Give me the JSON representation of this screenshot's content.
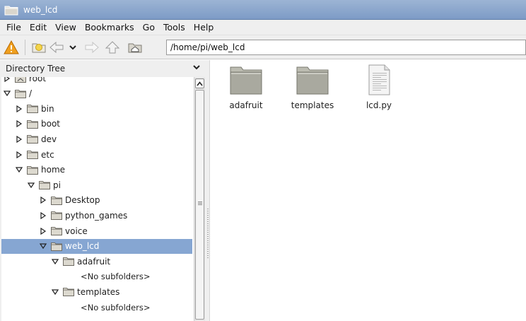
{
  "window": {
    "title": "web_lcd"
  },
  "menu": [
    "File",
    "Edit",
    "View",
    "Bookmarks",
    "Go",
    "Tools",
    "Help"
  ],
  "toolbar": {
    "icons": [
      "warning-icon",
      "new-folder-icon",
      "back-icon",
      "dropdown-chevron-icon",
      "forward-icon",
      "up-icon",
      "home-icon"
    ],
    "path": "/home/pi/web_lcd"
  },
  "sidebar": {
    "title": "Directory Tree",
    "tree": [
      {
        "label": "root",
        "level": 0,
        "expanded": false,
        "icon": "home-folder-icon"
      },
      {
        "label": "/",
        "level": 0,
        "expanded": true,
        "icon": "folder-icon"
      },
      {
        "label": "bin",
        "level": 1,
        "expanded": false,
        "icon": "folder-icon"
      },
      {
        "label": "boot",
        "level": 1,
        "expanded": false,
        "icon": "folder-icon"
      },
      {
        "label": "dev",
        "level": 1,
        "expanded": false,
        "icon": "folder-icon"
      },
      {
        "label": "etc",
        "level": 1,
        "expanded": false,
        "icon": "folder-icon"
      },
      {
        "label": "home",
        "level": 1,
        "expanded": true,
        "icon": "folder-icon"
      },
      {
        "label": "pi",
        "level": 2,
        "expanded": true,
        "icon": "folder-icon"
      },
      {
        "label": "Desktop",
        "level": 3,
        "expanded": false,
        "icon": "folder-icon"
      },
      {
        "label": "python_games",
        "level": 3,
        "expanded": false,
        "icon": "folder-icon"
      },
      {
        "label": "voice",
        "level": 3,
        "expanded": false,
        "icon": "folder-icon"
      },
      {
        "label": "web_lcd",
        "level": 3,
        "expanded": true,
        "icon": "folder-icon",
        "selected": true
      },
      {
        "label": "adafruit",
        "level": 4,
        "expanded": true,
        "icon": "folder-icon"
      },
      {
        "label": "<No subfolders>",
        "level": 5,
        "placeholder": true
      },
      {
        "label": "templates",
        "level": 4,
        "expanded": true,
        "icon": "folder-icon"
      },
      {
        "label": "<No subfolders>",
        "level": 5,
        "placeholder": true
      }
    ]
  },
  "files": [
    {
      "name": "adafruit",
      "type": "folder",
      "icon": "folder-icon"
    },
    {
      "name": "templates",
      "type": "folder",
      "icon": "folder-icon"
    },
    {
      "name": "lcd.py",
      "type": "file",
      "icon": "text-file-icon"
    }
  ],
  "colors": {
    "titlebar": "#8aa6cc",
    "selection": "#86a6d2",
    "warning": "#f0a020"
  }
}
